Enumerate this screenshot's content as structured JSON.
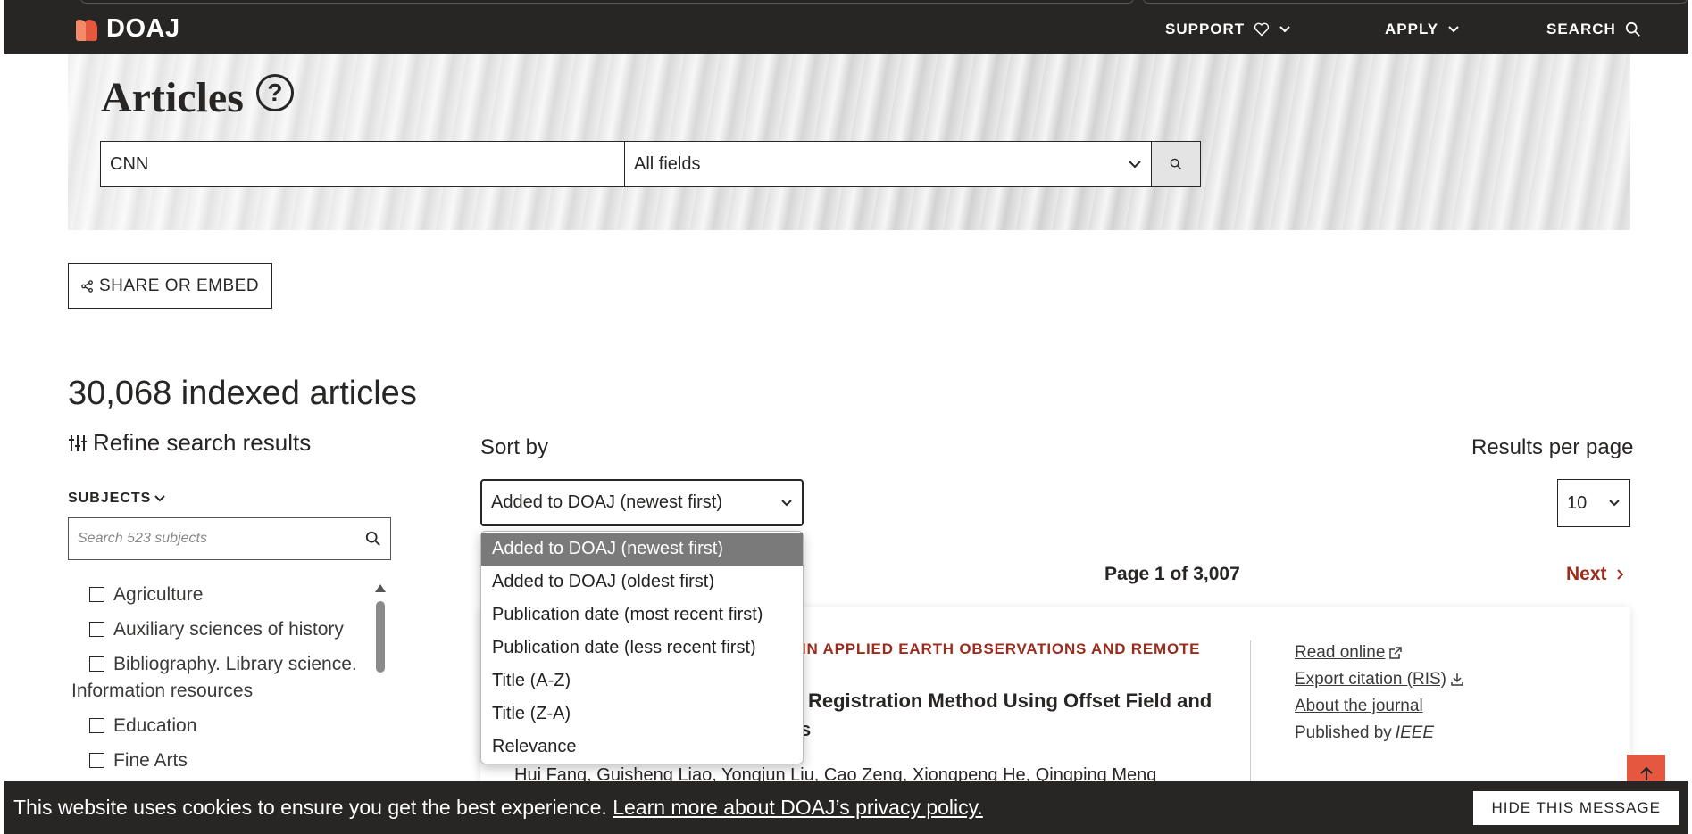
{
  "nav": {
    "logo": "DOAJ",
    "support": "SUPPORT",
    "apply": "APPLY",
    "search": "SEARCH"
  },
  "hero": {
    "title": "Articles",
    "help": "?",
    "query": "CNN",
    "field": "All fields"
  },
  "share_label": "SHARE OR EMBED",
  "results_count": "30,068 indexed articles",
  "refine_label": "Refine search results",
  "subjects": {
    "heading": "SUBJECTS",
    "search_placeholder": "Search 523 subjects",
    "items": [
      "Agriculture",
      "Auxiliary sciences of history",
      "Bibliography. Library science.",
      "Information resources",
      "Education",
      "Fine Arts"
    ]
  },
  "sort": {
    "label": "Sort by",
    "selected": "Added to DOAJ (newest first)",
    "options": [
      "Added to DOAJ (newest first)",
      "Added to DOAJ (oldest first)",
      "Publication date (most recent first)",
      "Publication date (less recent first)",
      "Title (A-Z)",
      "Title (Z-A)",
      "Relevance"
    ]
  },
  "results_per_page": {
    "label": "Results per page",
    "value": "10"
  },
  "pagination": {
    "info": "Page 1 of 3,007",
    "next": "Next"
  },
  "article": {
    "journal": "IN APPLIED EARTH OBSERVATIONS AND REMOTE",
    "title_line1": "Registration Method Using Offset Field and",
    "title_line2": "s",
    "authors": "Hui Fang, Guisheng Liao, Yongjun Liu, Cao Zeng, Xiongpeng He, Qingping Meng",
    "read_online": "Read online",
    "export_citation": "Export citation (RIS)",
    "about_journal": "About the journal",
    "published_by_prefix": "Published by",
    "publisher": "IEEE"
  },
  "cookie": {
    "message": "This website uses cookies to ensure you get the best experience.",
    "link": "Learn more about DOAJ’s privacy policy.",
    "hide": "HIDE THIS MESSAGE"
  },
  "colors": {
    "nav_bg": "#282624",
    "accent": "#e5573f",
    "link_red": "#9b2c1c"
  }
}
